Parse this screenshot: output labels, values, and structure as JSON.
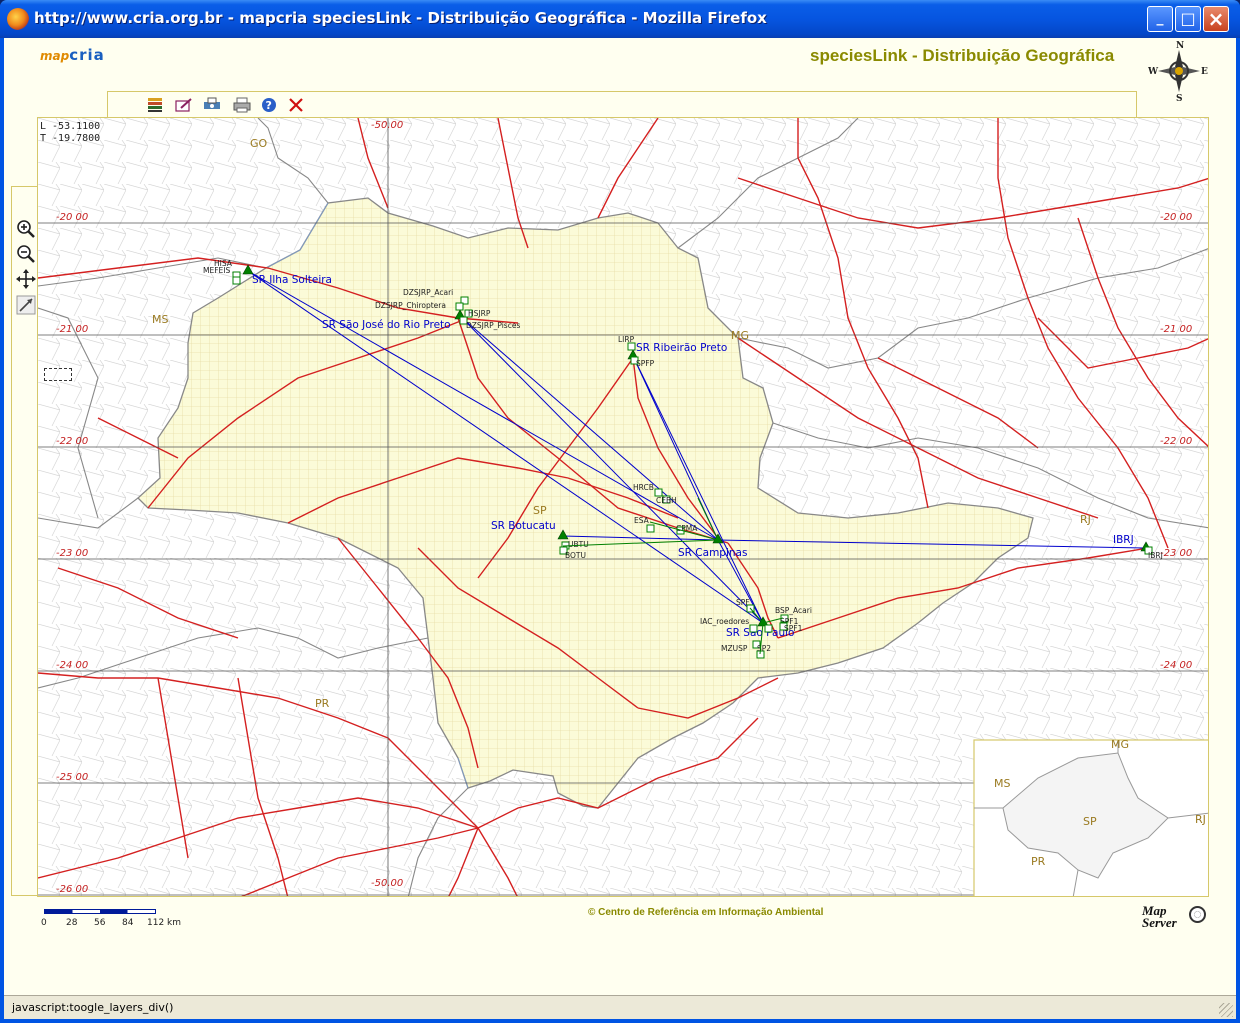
{
  "window": {
    "title": "http://www.cria.org.br - mapcria speciesLink - Distribuição Geográfica - Mozilla Firefox",
    "minimize_glyph": "_",
    "maximize_glyph": "□",
    "close_glyph": "×"
  },
  "header": {
    "logo_map": "map",
    "logo_cria": "cria",
    "page_title": "speciesLink - Distribuição Geográfica",
    "compass": {
      "n": "N",
      "s": "S",
      "e": "E",
      "w": "W"
    }
  },
  "toolbar": {
    "icons": [
      "layers-icon",
      "edit-map-icon",
      "print-preview-icon",
      "print-icon",
      "help-icon",
      "close-icon"
    ]
  },
  "side_tools": {
    "icons": [
      "zoom-in-icon",
      "zoom-out-icon",
      "pan-icon",
      "select-icon"
    ]
  },
  "map": {
    "coord_lon": "L -53.1100",
    "coord_lat": "T -19.7800",
    "lat_labels": [
      "-20 00",
      "-21 00",
      "-22 00",
      "-23 00",
      "-24 00",
      "-25 00",
      "-26 00"
    ],
    "lon_labels": [
      "-50.00",
      "-50.00"
    ],
    "state_labels": [
      "GO",
      "MS",
      "MG",
      "SP",
      "RJ",
      "PR"
    ],
    "stations": [
      "SR Ilha Solteira",
      "SR São José do Rio Preto",
      "SR Ribeirão Preto",
      "SR Botucatu",
      "SR Campinas",
      "SR São Paulo",
      "IBRJ"
    ],
    "collections": [
      "HISA",
      "MEFEIS",
      "DZSJRP_Acari",
      "DZSJRP_Chiroptera",
      "HSJRP",
      "DZSJRP_Pisces",
      "LIRP",
      "SPFP",
      "HRCB",
      "CEBH",
      "ESA",
      "CPMA",
      "UBTU",
      "BOTU",
      "SPF",
      "BSP_Acari",
      "IAC_roedores",
      "SPF1",
      "SPF1",
      "MZUSP",
      "SP2",
      "IBRJ"
    ],
    "accent_station": "#0000cc",
    "accent_roads": "#d42020",
    "accent_marker": "#008000",
    "state_fill": "#fbfbd8"
  },
  "inset": {
    "state_labels": [
      "MG",
      "MS",
      "SP",
      "RJ",
      "PR"
    ]
  },
  "footer": {
    "scale_labels": [
      "0",
      "28",
      "56",
      "84",
      "112 km"
    ],
    "copyright": "© Centro de Referência em Informação Ambiental",
    "mapserver_line1": "Map",
    "mapserver_line2": "Server"
  },
  "status": {
    "text": "javascript:toogle_layers_div()"
  }
}
